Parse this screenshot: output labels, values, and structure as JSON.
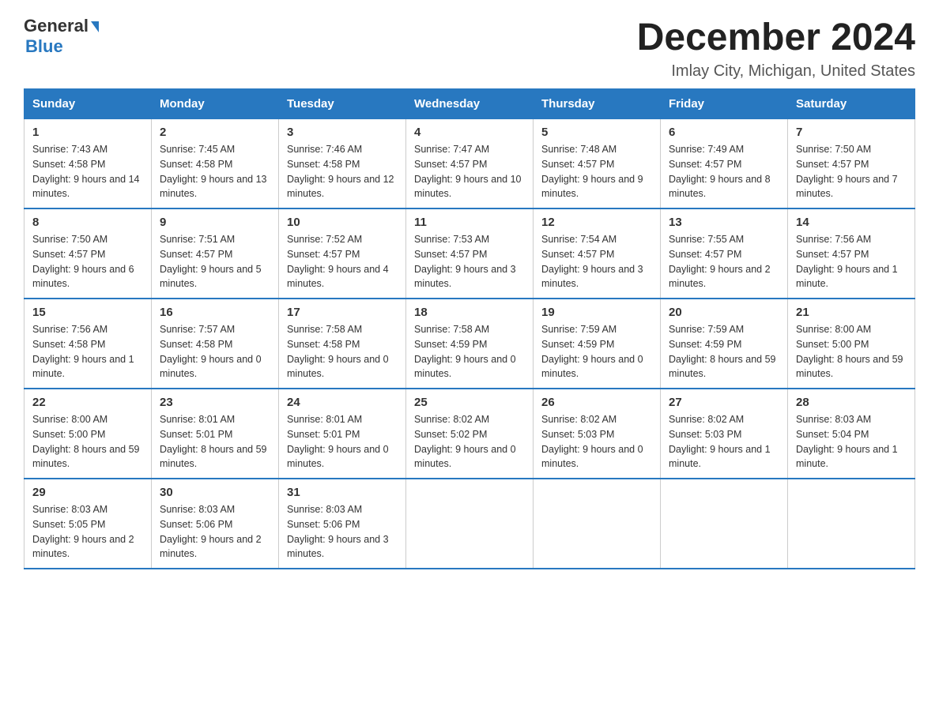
{
  "header": {
    "logo_general": "General",
    "logo_blue": "Blue",
    "title": "December 2024",
    "subtitle": "Imlay City, Michigan, United States"
  },
  "days_of_week": [
    "Sunday",
    "Monday",
    "Tuesday",
    "Wednesday",
    "Thursday",
    "Friday",
    "Saturday"
  ],
  "weeks": [
    [
      {
        "date": "1",
        "sunrise": "Sunrise: 7:43 AM",
        "sunset": "Sunset: 4:58 PM",
        "daylight": "Daylight: 9 hours and 14 minutes."
      },
      {
        "date": "2",
        "sunrise": "Sunrise: 7:45 AM",
        "sunset": "Sunset: 4:58 PM",
        "daylight": "Daylight: 9 hours and 13 minutes."
      },
      {
        "date": "3",
        "sunrise": "Sunrise: 7:46 AM",
        "sunset": "Sunset: 4:58 PM",
        "daylight": "Daylight: 9 hours and 12 minutes."
      },
      {
        "date": "4",
        "sunrise": "Sunrise: 7:47 AM",
        "sunset": "Sunset: 4:57 PM",
        "daylight": "Daylight: 9 hours and 10 minutes."
      },
      {
        "date": "5",
        "sunrise": "Sunrise: 7:48 AM",
        "sunset": "Sunset: 4:57 PM",
        "daylight": "Daylight: 9 hours and 9 minutes."
      },
      {
        "date": "6",
        "sunrise": "Sunrise: 7:49 AM",
        "sunset": "Sunset: 4:57 PM",
        "daylight": "Daylight: 9 hours and 8 minutes."
      },
      {
        "date": "7",
        "sunrise": "Sunrise: 7:50 AM",
        "sunset": "Sunset: 4:57 PM",
        "daylight": "Daylight: 9 hours and 7 minutes."
      }
    ],
    [
      {
        "date": "8",
        "sunrise": "Sunrise: 7:50 AM",
        "sunset": "Sunset: 4:57 PM",
        "daylight": "Daylight: 9 hours and 6 minutes."
      },
      {
        "date": "9",
        "sunrise": "Sunrise: 7:51 AM",
        "sunset": "Sunset: 4:57 PM",
        "daylight": "Daylight: 9 hours and 5 minutes."
      },
      {
        "date": "10",
        "sunrise": "Sunrise: 7:52 AM",
        "sunset": "Sunset: 4:57 PM",
        "daylight": "Daylight: 9 hours and 4 minutes."
      },
      {
        "date": "11",
        "sunrise": "Sunrise: 7:53 AM",
        "sunset": "Sunset: 4:57 PM",
        "daylight": "Daylight: 9 hours and 3 minutes."
      },
      {
        "date": "12",
        "sunrise": "Sunrise: 7:54 AM",
        "sunset": "Sunset: 4:57 PM",
        "daylight": "Daylight: 9 hours and 3 minutes."
      },
      {
        "date": "13",
        "sunrise": "Sunrise: 7:55 AM",
        "sunset": "Sunset: 4:57 PM",
        "daylight": "Daylight: 9 hours and 2 minutes."
      },
      {
        "date": "14",
        "sunrise": "Sunrise: 7:56 AM",
        "sunset": "Sunset: 4:57 PM",
        "daylight": "Daylight: 9 hours and 1 minute."
      }
    ],
    [
      {
        "date": "15",
        "sunrise": "Sunrise: 7:56 AM",
        "sunset": "Sunset: 4:58 PM",
        "daylight": "Daylight: 9 hours and 1 minute."
      },
      {
        "date": "16",
        "sunrise": "Sunrise: 7:57 AM",
        "sunset": "Sunset: 4:58 PM",
        "daylight": "Daylight: 9 hours and 0 minutes."
      },
      {
        "date": "17",
        "sunrise": "Sunrise: 7:58 AM",
        "sunset": "Sunset: 4:58 PM",
        "daylight": "Daylight: 9 hours and 0 minutes."
      },
      {
        "date": "18",
        "sunrise": "Sunrise: 7:58 AM",
        "sunset": "Sunset: 4:59 PM",
        "daylight": "Daylight: 9 hours and 0 minutes."
      },
      {
        "date": "19",
        "sunrise": "Sunrise: 7:59 AM",
        "sunset": "Sunset: 4:59 PM",
        "daylight": "Daylight: 9 hours and 0 minutes."
      },
      {
        "date": "20",
        "sunrise": "Sunrise: 7:59 AM",
        "sunset": "Sunset: 4:59 PM",
        "daylight": "Daylight: 8 hours and 59 minutes."
      },
      {
        "date": "21",
        "sunrise": "Sunrise: 8:00 AM",
        "sunset": "Sunset: 5:00 PM",
        "daylight": "Daylight: 8 hours and 59 minutes."
      }
    ],
    [
      {
        "date": "22",
        "sunrise": "Sunrise: 8:00 AM",
        "sunset": "Sunset: 5:00 PM",
        "daylight": "Daylight: 8 hours and 59 minutes."
      },
      {
        "date": "23",
        "sunrise": "Sunrise: 8:01 AM",
        "sunset": "Sunset: 5:01 PM",
        "daylight": "Daylight: 8 hours and 59 minutes."
      },
      {
        "date": "24",
        "sunrise": "Sunrise: 8:01 AM",
        "sunset": "Sunset: 5:01 PM",
        "daylight": "Daylight: 9 hours and 0 minutes."
      },
      {
        "date": "25",
        "sunrise": "Sunrise: 8:02 AM",
        "sunset": "Sunset: 5:02 PM",
        "daylight": "Daylight: 9 hours and 0 minutes."
      },
      {
        "date": "26",
        "sunrise": "Sunrise: 8:02 AM",
        "sunset": "Sunset: 5:03 PM",
        "daylight": "Daylight: 9 hours and 0 minutes."
      },
      {
        "date": "27",
        "sunrise": "Sunrise: 8:02 AM",
        "sunset": "Sunset: 5:03 PM",
        "daylight": "Daylight: 9 hours and 1 minute."
      },
      {
        "date": "28",
        "sunrise": "Sunrise: 8:03 AM",
        "sunset": "Sunset: 5:04 PM",
        "daylight": "Daylight: 9 hours and 1 minute."
      }
    ],
    [
      {
        "date": "29",
        "sunrise": "Sunrise: 8:03 AM",
        "sunset": "Sunset: 5:05 PM",
        "daylight": "Daylight: 9 hours and 2 minutes."
      },
      {
        "date": "30",
        "sunrise": "Sunrise: 8:03 AM",
        "sunset": "Sunset: 5:06 PM",
        "daylight": "Daylight: 9 hours and 2 minutes."
      },
      {
        "date": "31",
        "sunrise": "Sunrise: 8:03 AM",
        "sunset": "Sunset: 5:06 PM",
        "daylight": "Daylight: 9 hours and 3 minutes."
      },
      null,
      null,
      null,
      null
    ]
  ]
}
